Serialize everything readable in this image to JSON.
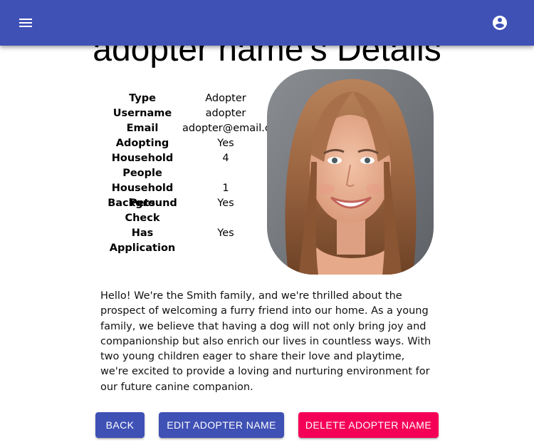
{
  "colors": {
    "primary": "#3f51b5",
    "secondary": "#f50057"
  },
  "appbar": {
    "menu_icon": "menu-icon",
    "account_icon": "account-circle-icon"
  },
  "page": {
    "title": "adopter name's Details"
  },
  "details": [
    {
      "label": "Type",
      "value": "Adopter"
    },
    {
      "label": "Username",
      "value": "adopter"
    },
    {
      "label": "Email",
      "value": "adopter@email.com"
    },
    {
      "label": "Adopting",
      "value": "Yes"
    },
    {
      "label": "Household People",
      "value": "4"
    },
    {
      "label": "Household Pets",
      "value": "1"
    },
    {
      "label": "Background Check",
      "value": "Yes"
    },
    {
      "label": "Has Application",
      "value": "Yes"
    }
  ],
  "bio": "Hello! We're the Smith family, and we're thrilled about the prospect of welcoming a furry friend into our home. As a young family, we believe that having a dog will not only bring joy and companionship but also enrich our lives in countless ways. With two young children eager to share their love and playtime, we're excited to provide a loving and nurturing environment for our future canine companion.",
  "actions": {
    "back": "Back",
    "edit": "Edit adopter name",
    "delete": "Delete adopter name"
  }
}
